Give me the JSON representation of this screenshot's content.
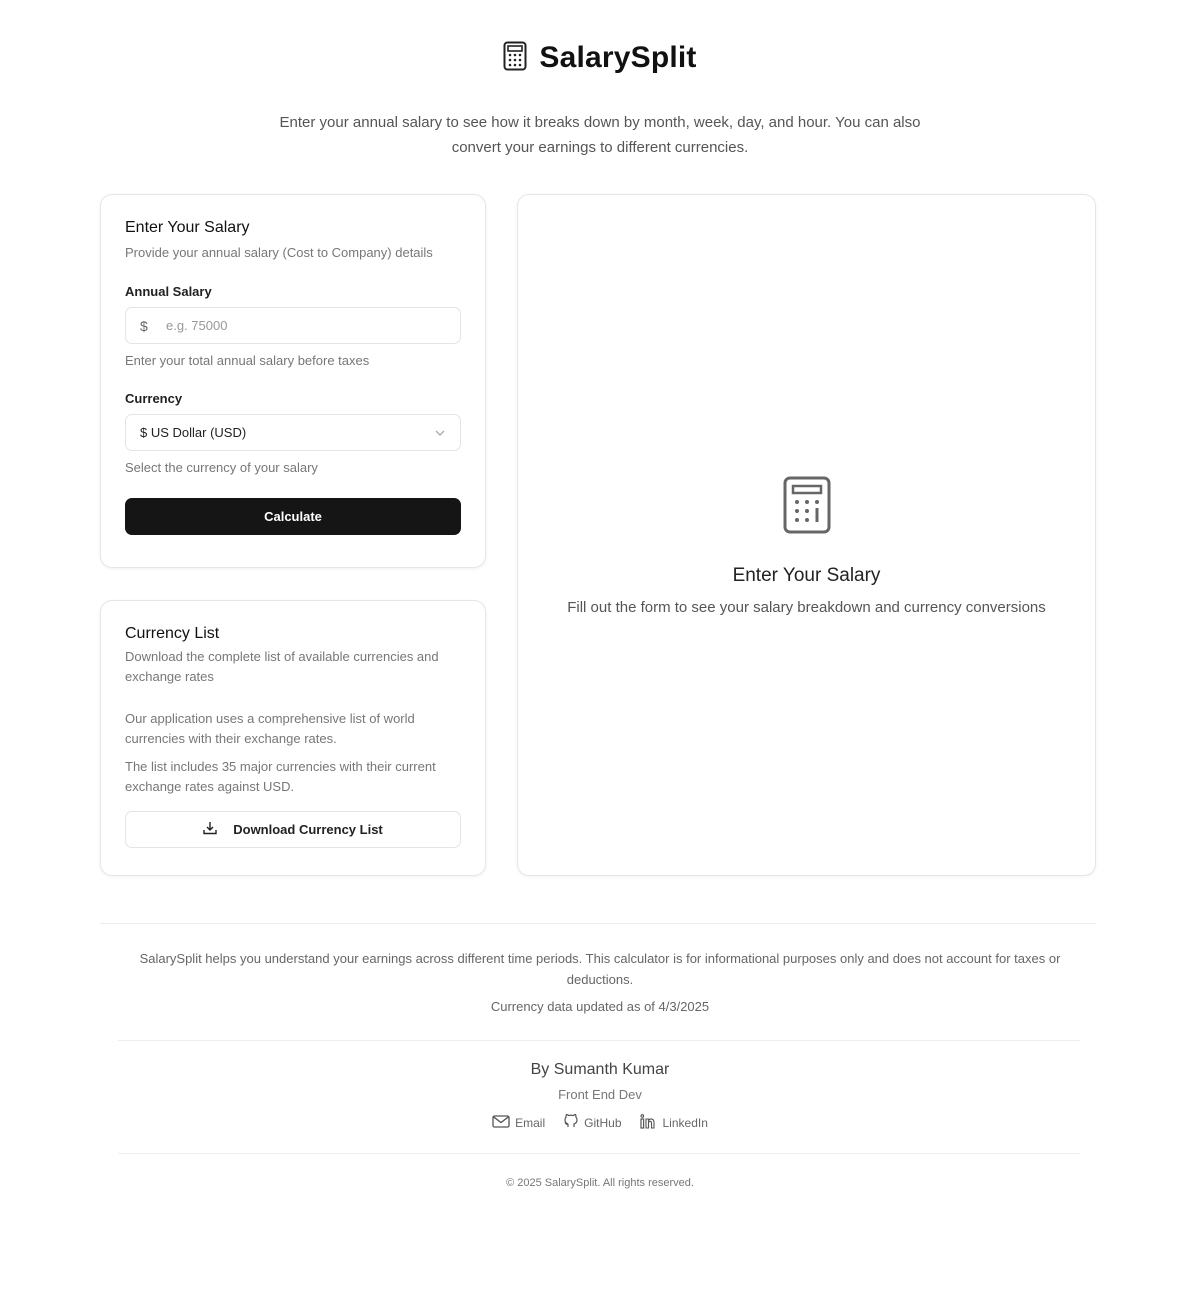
{
  "header": {
    "title": "SalarySplit",
    "icon": "calculator-icon",
    "intro": "Enter your annual salary to see how it breaks down by month, week, day, and hour. You can also convert your earnings to different currencies."
  },
  "salary_form": {
    "title": "Enter Your Salary",
    "description": "Provide your annual salary (Cost to Company) details",
    "annual_label": "Annual Salary",
    "currency_symbol": "$",
    "annual_placeholder": "e.g. 75000",
    "annual_value": "",
    "annual_helper": "Enter your total annual salary before taxes",
    "currency_label": "Currency",
    "currency_selected": "$ US Dollar (USD)",
    "currency_helper": "Select the currency of your salary",
    "calculate_label": "Calculate"
  },
  "currency_list": {
    "title": "Currency List",
    "description": "Download the complete list of available currencies and exchange rates",
    "text1": "Our application uses a comprehensive list of world currencies with their exchange rates.",
    "text2": "The list includes 35 major currencies with their current exchange rates against USD.",
    "download_label": "Download Currency List"
  },
  "result": {
    "title": "Enter Your Salary",
    "description": "Fill out the form to see your salary breakdown and currency conversions"
  },
  "footer": {
    "disclaimer": "SalarySplit helps you understand your earnings across different time periods. This calculator is for informational purposes only and does not account for taxes or deductions.",
    "updated": "Currency data updated as of 4/3/2025",
    "author": "By Sumanth Kumar",
    "role": "Front End Dev",
    "links": [
      {
        "label": "Email",
        "icon": "mail-icon"
      },
      {
        "label": "GitHub",
        "icon": "github-icon"
      },
      {
        "label": "LinkedIn",
        "icon": "linkedin-icon"
      }
    ],
    "copyright": "© 2025 SalarySplit. All rights reserved."
  },
  "colors": {
    "primary_button": "#151515",
    "border": "#e6e6e6",
    "muted_text": "#777777"
  }
}
